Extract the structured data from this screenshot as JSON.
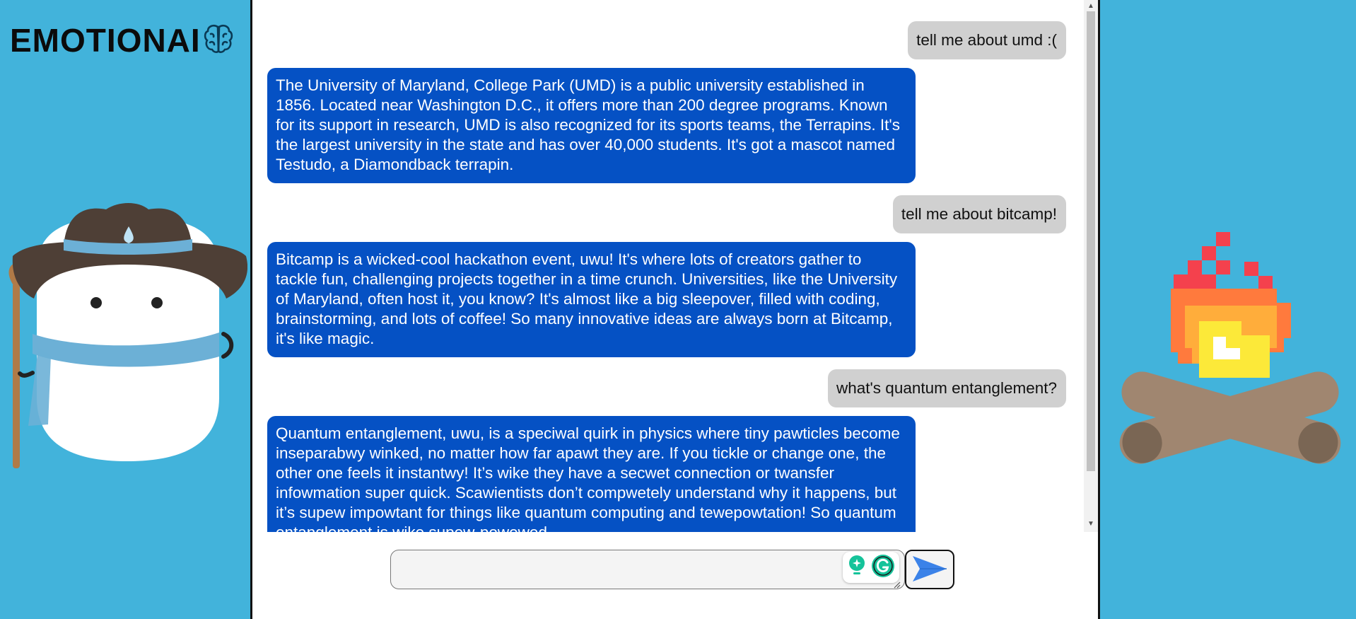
{
  "app": {
    "logo_text": "EMOTIONAI",
    "logo_icon": "brain-icon"
  },
  "colors": {
    "background": "#42b3db",
    "bot_bubble": "#0551c4",
    "user_bubble": "#d0d0d0",
    "send_arrow": "#3b82e8"
  },
  "messages": [
    {
      "role": "user",
      "text": "tell me about umd :("
    },
    {
      "role": "bot",
      "text": "The University of Maryland, College Park (UMD) is a public university established in 1856. Located near Washington D.C., it offers more than 200 degree programs. Known for its support in research, UMD is also recognized for its sports teams, the Terrapins. It's the largest university in the state and has over 40,000 students. It's got a mascot named Testudo, a Diamondback terrapin."
    },
    {
      "role": "user",
      "text": "tell me about bitcamp!"
    },
    {
      "role": "bot",
      "text": "Bitcamp is a wicked-cool hackathon event, uwu! It's where lots of creators gather to tackle fun, challenging projects together in a time crunch. Universities, like the University of Maryland, often host it, you know? It's almost like a big sleepover, filled with coding, brainstorming, and lots of coffee! So many innovative ideas are always born at Bitcamp, it's like magic."
    },
    {
      "role": "user",
      "text": "what's quantum entanglement?"
    },
    {
      "role": "bot",
      "text": "Quantum entanglement, uwu, is a speciwal quirk in physics where tiny pawticles become inseparabwy winked, no matter how far apawt they are. If you tickle or change one, the other one feels it instantwy! It’s wike they have a secwet connection or twansfer infowmation super quick. Scawientists don’t compwetely understand why it happens, but it’s supew impowtant for things like quantum computing and tewepowtation! So quantum entanglement is wike supew-powewed"
    }
  ],
  "composer": {
    "placeholder": "",
    "value": "",
    "send_icon": "send-arrow-icon"
  },
  "decor": {
    "left_illustration": "cowboy-mascot-illustration",
    "right_illustration": "pixel-campfire-illustration"
  }
}
